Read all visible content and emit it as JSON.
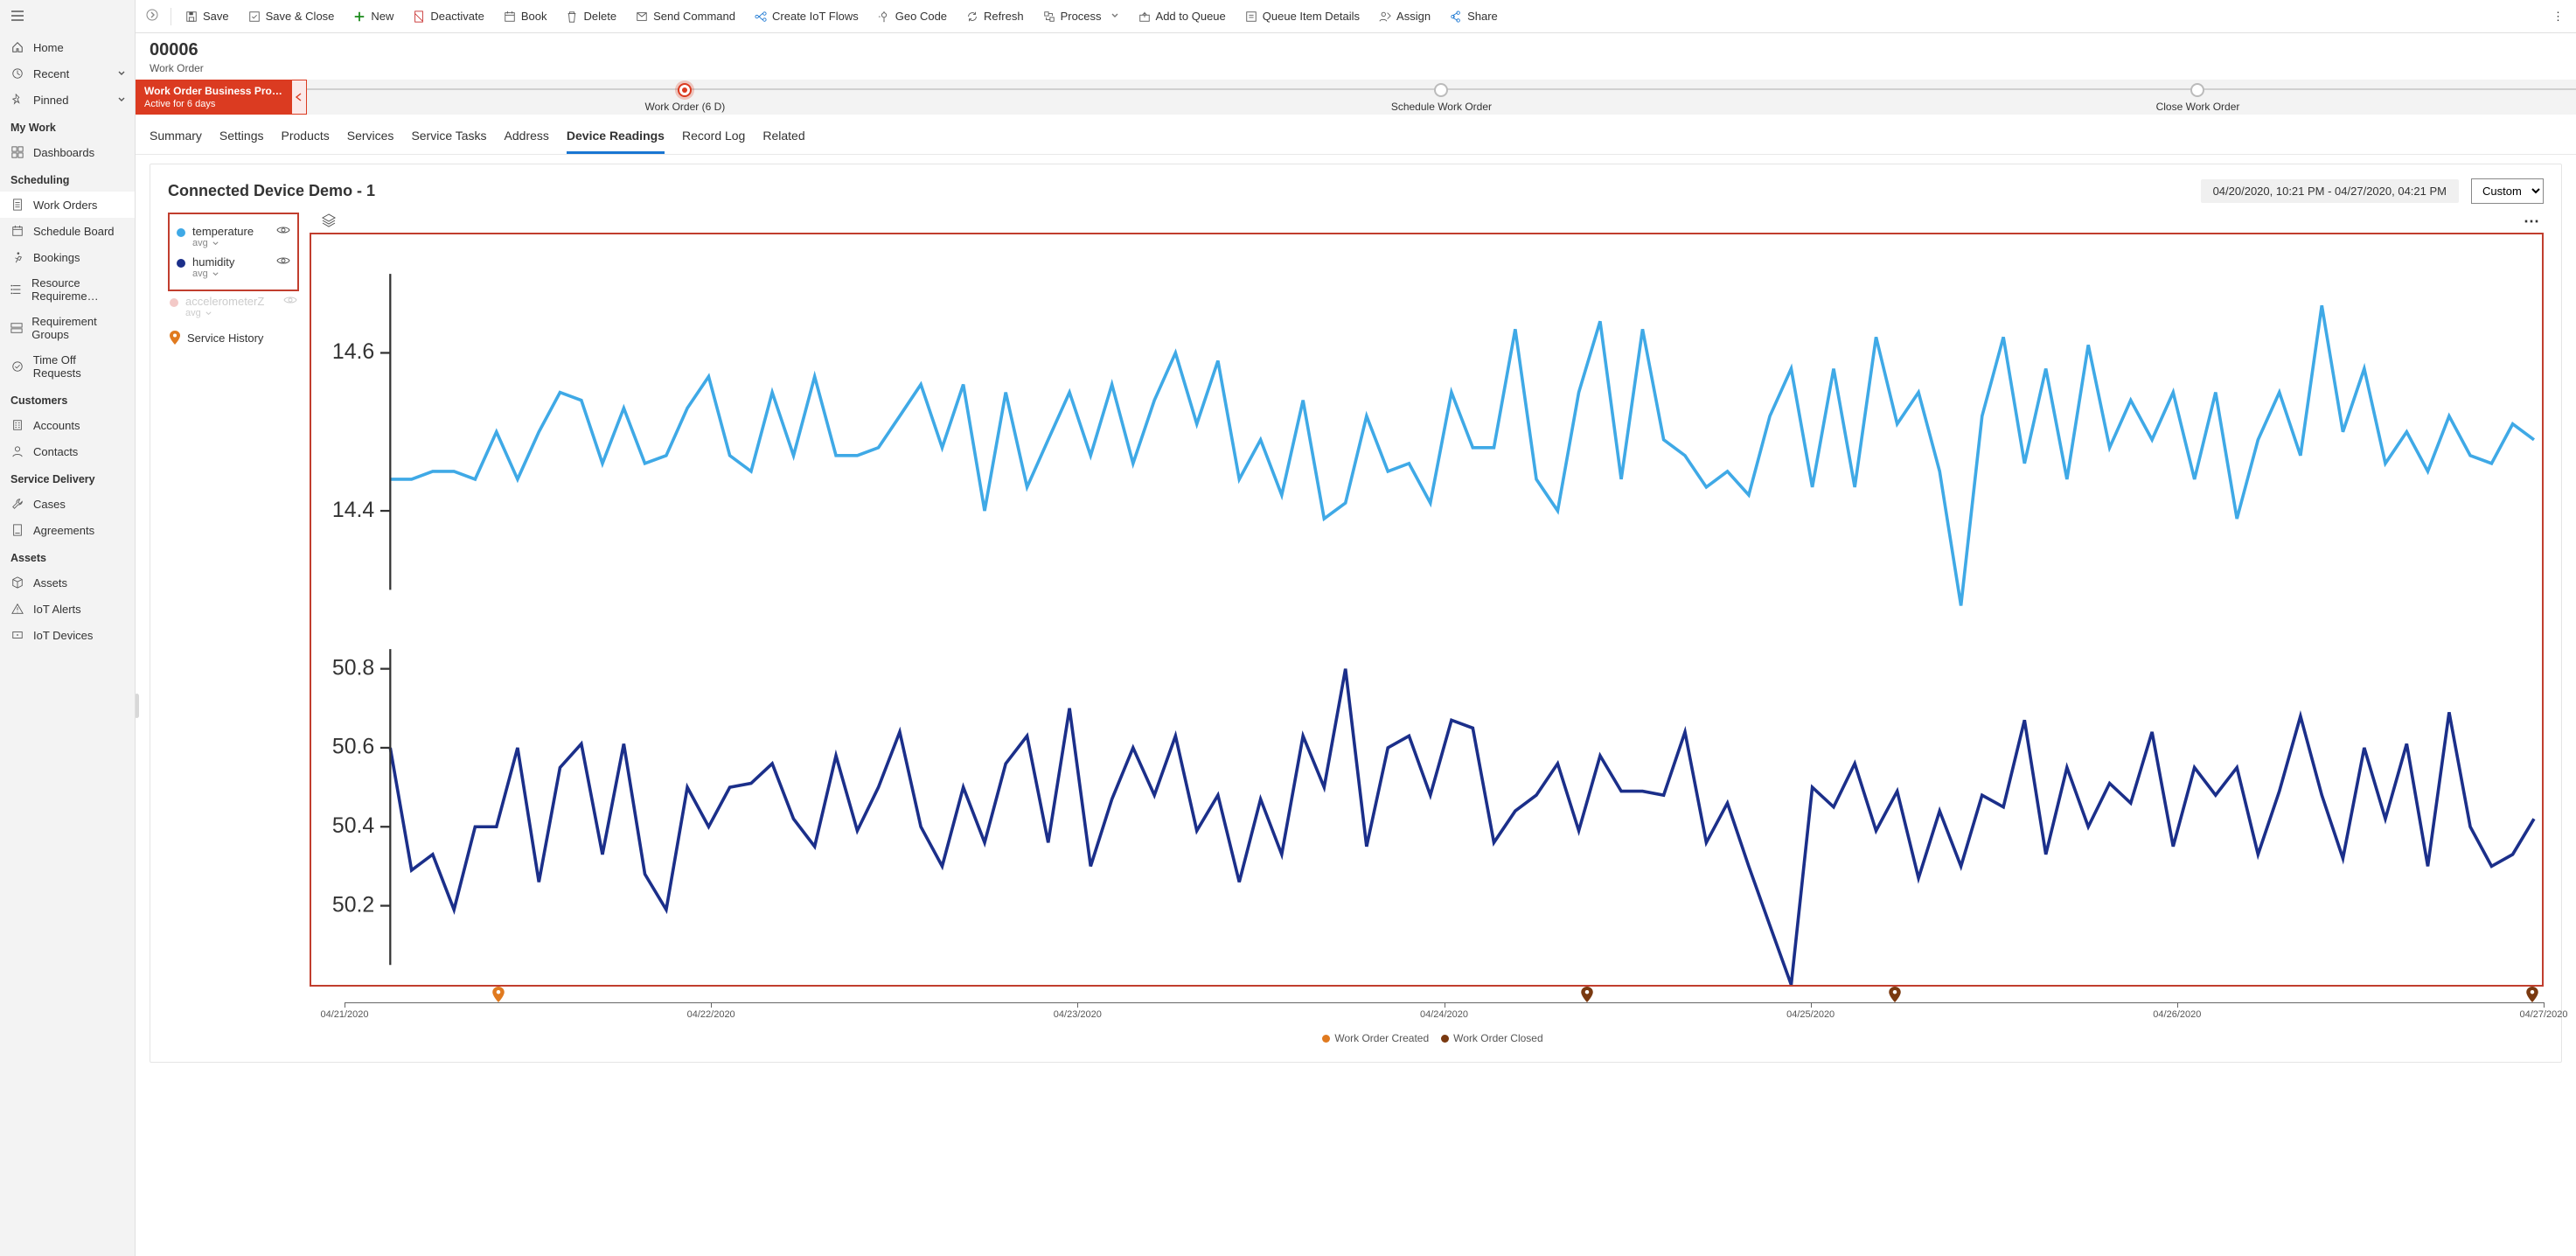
{
  "sidebar": {
    "top": [
      {
        "label": "Home",
        "icon": "home"
      },
      {
        "label": "Recent",
        "icon": "clock",
        "chev": true
      },
      {
        "label": "Pinned",
        "icon": "pin",
        "chev": true
      }
    ],
    "groups": [
      {
        "label": "My Work",
        "items": [
          {
            "label": "Dashboards",
            "icon": "dashboard"
          }
        ]
      },
      {
        "label": "Scheduling",
        "items": [
          {
            "label": "Work Orders",
            "icon": "doc",
            "selected": true
          },
          {
            "label": "Schedule Board",
            "icon": "calendar"
          },
          {
            "label": "Bookings",
            "icon": "run"
          },
          {
            "label": "Resource Requireme…",
            "icon": "req"
          },
          {
            "label": "Requirement Groups",
            "icon": "group"
          },
          {
            "label": "Time Off Requests",
            "icon": "timeoff"
          }
        ]
      },
      {
        "label": "Customers",
        "items": [
          {
            "label": "Accounts",
            "icon": "building"
          },
          {
            "label": "Contacts",
            "icon": "person"
          }
        ]
      },
      {
        "label": "Service Delivery",
        "items": [
          {
            "label": "Cases",
            "icon": "wrench"
          },
          {
            "label": "Agreements",
            "icon": "doc2"
          }
        ]
      },
      {
        "label": "Assets",
        "items": [
          {
            "label": "Assets",
            "icon": "cube"
          },
          {
            "label": "IoT Alerts",
            "icon": "alert"
          },
          {
            "label": "IoT Devices",
            "icon": "device"
          }
        ]
      }
    ]
  },
  "commandBar": [
    {
      "label": "Save",
      "icon": "save"
    },
    {
      "label": "Save & Close",
      "icon": "saveclose"
    },
    {
      "label": "New",
      "icon": "plus",
      "iconClass": "green"
    },
    {
      "label": "Deactivate",
      "icon": "deactivate",
      "iconClass": "red"
    },
    {
      "label": "Book",
      "icon": "calendar"
    },
    {
      "label": "Delete",
      "icon": "trash"
    },
    {
      "label": "Send Command",
      "icon": "send"
    },
    {
      "label": "Create IoT Flows",
      "icon": "flow",
      "iconClass": "blue"
    },
    {
      "label": "Geo Code",
      "icon": "geo"
    },
    {
      "label": "Refresh",
      "icon": "refresh"
    },
    {
      "label": "Process",
      "icon": "process",
      "chev": true
    },
    {
      "label": "Add to Queue",
      "icon": "queue"
    },
    {
      "label": "Queue Item Details",
      "icon": "details"
    },
    {
      "label": "Assign",
      "icon": "assign"
    },
    {
      "label": "Share",
      "icon": "share",
      "iconClass": "blue"
    }
  ],
  "header": {
    "title": "00006",
    "subtitle": "Work Order"
  },
  "businessProcess": {
    "name": "Work Order Business Pro…",
    "active_for": "Active for 6 days",
    "stages": [
      {
        "label": "Work Order  (6 D)",
        "active": true
      },
      {
        "label": "Schedule Work Order"
      },
      {
        "label": "Close Work Order"
      }
    ]
  },
  "tabs": [
    "Summary",
    "Settings",
    "Products",
    "Services",
    "Service Tasks",
    "Address",
    "Device Readings",
    "Record Log",
    "Related"
  ],
  "activeTab": "Device Readings",
  "panel": {
    "title": "Connected Device Demo - 1",
    "dateRange": "04/20/2020, 10:21 PM - 04/27/2020, 04:21 PM",
    "rangeOptions": [
      "Custom"
    ],
    "rangeSelected": "Custom",
    "legend": [
      {
        "name": "temperature",
        "agg": "avg",
        "color": "#3fa9e6",
        "visible": true
      },
      {
        "name": "humidity",
        "agg": "avg",
        "color": "#1b2f8a",
        "visible": true
      },
      {
        "name": "accelerometerZ",
        "agg": "avg",
        "color": "#f3c9c7",
        "visible": false
      }
    ],
    "serviceHistoryLabel": "Service History",
    "legend2": [
      {
        "label": "Work Order Created",
        "color": "#e07a1f"
      },
      {
        "label": "Work Order Closed",
        "color": "#7a3910"
      }
    ]
  },
  "chart_data": [
    {
      "type": "line",
      "series_name": "temperature",
      "color": "#3fa9e6",
      "ylim": [
        14.3,
        14.7
      ],
      "yticks": [
        14.4,
        14.6
      ],
      "x_range_days": [
        "04/21/2020",
        "04/27/2020"
      ],
      "values": [
        14.44,
        14.44,
        14.45,
        14.45,
        14.44,
        14.5,
        14.44,
        14.5,
        14.55,
        14.54,
        14.46,
        14.53,
        14.46,
        14.47,
        14.53,
        14.57,
        14.47,
        14.45,
        14.55,
        14.47,
        14.57,
        14.47,
        14.47,
        14.48,
        14.52,
        14.56,
        14.48,
        14.56,
        14.4,
        14.55,
        14.43,
        14.49,
        14.55,
        14.47,
        14.56,
        14.46,
        14.54,
        14.6,
        14.51,
        14.59,
        14.44,
        14.49,
        14.42,
        14.54,
        14.39,
        14.41,
        14.52,
        14.45,
        14.46,
        14.41,
        14.55,
        14.48,
        14.48,
        14.63,
        14.44,
        14.4,
        14.55,
        14.64,
        14.44,
        14.63,
        14.49,
        14.47,
        14.43,
        14.45,
        14.42,
        14.52,
        14.58,
        14.43,
        14.58,
        14.43,
        14.62,
        14.51,
        14.55,
        14.45,
        14.28,
        14.52,
        14.62,
        14.46,
        14.58,
        14.44,
        14.61,
        14.48,
        14.54,
        14.49,
        14.55,
        14.44,
        14.55,
        14.39,
        14.49,
        14.55,
        14.47,
        14.66,
        14.5,
        14.58,
        14.46,
        14.5,
        14.45,
        14.52,
        14.47,
        14.46,
        14.51,
        14.49
      ]
    },
    {
      "type": "line",
      "series_name": "humidity",
      "color": "#1b2f8a",
      "ylim": [
        50.05,
        50.85
      ],
      "yticks": [
        50.2,
        50.4,
        50.6,
        50.8
      ],
      "x_range_days": [
        "04/21/2020",
        "04/27/2020"
      ],
      "values": [
        50.6,
        50.29,
        50.33,
        50.19,
        50.4,
        50.4,
        50.6,
        50.26,
        50.55,
        50.61,
        50.33,
        50.61,
        50.28,
        50.19,
        50.5,
        50.4,
        50.5,
        50.51,
        50.56,
        50.42,
        50.35,
        50.58,
        50.39,
        50.5,
        50.64,
        50.4,
        50.3,
        50.5,
        50.36,
        50.56,
        50.63,
        50.36,
        50.7,
        50.3,
        50.47,
        50.6,
        50.48,
        50.63,
        50.39,
        50.48,
        50.26,
        50.47,
        50.33,
        50.63,
        50.5,
        50.8,
        50.35,
        50.6,
        50.63,
        50.48,
        50.67,
        50.65,
        50.36,
        50.44,
        50.48,
        50.56,
        50.39,
        50.58,
        50.49,
        50.49,
        50.48,
        50.64,
        50.36,
        50.46,
        50.3,
        50.15,
        50.0,
        50.5,
        50.45,
        50.56,
        50.39,
        50.49,
        50.27,
        50.44,
        50.3,
        50.48,
        50.45,
        50.67,
        50.33,
        50.55,
        50.4,
        50.51,
        50.46,
        50.64,
        50.35,
        50.55,
        50.48,
        50.55,
        50.33,
        50.49,
        50.68,
        50.48,
        50.32,
        50.6,
        50.42,
        50.61,
        50.3,
        50.69,
        50.4,
        50.3,
        50.33,
        50.42
      ]
    }
  ],
  "timeline": {
    "ticks": [
      "04/21/2020",
      "04/22/2020",
      "04/23/2020",
      "04/24/2020",
      "04/25/2020",
      "04/26/2020",
      "04/27/2020"
    ],
    "pins": [
      {
        "frac": 0.07,
        "color": "#e07a1f"
      },
      {
        "frac": 0.565,
        "color": "#7a3910"
      },
      {
        "frac": 0.705,
        "color": "#7a3910"
      },
      {
        "frac": 0.995,
        "color": "#7a3910"
      }
    ]
  }
}
